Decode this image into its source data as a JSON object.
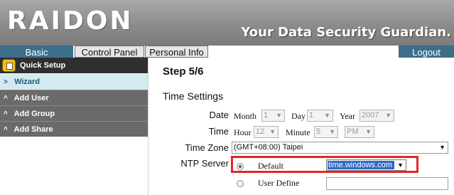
{
  "header": {
    "logo": "RAIDON",
    "tagline": "Your Data Security Guardian."
  },
  "nav": {
    "tabs": [
      "Basic",
      "Control Panel",
      "Personal Info"
    ],
    "logout": "Logout"
  },
  "sidebar": {
    "section": "Quick Setup",
    "items": [
      {
        "label": "Wizard",
        "arrow": ">"
      },
      {
        "label": "Add User",
        "arrow": "^"
      },
      {
        "label": "Add Group",
        "arrow": "^"
      },
      {
        "label": "Add Share",
        "arrow": "^"
      }
    ]
  },
  "main": {
    "step": "Step 5/6",
    "section": "Time Settings",
    "date": {
      "label": "Date",
      "month_label": "Month",
      "month": "1",
      "day_label": "Day",
      "day": "1",
      "year_label": "Year",
      "year": "2007"
    },
    "time": {
      "label": "Time",
      "hour_label": "Hour",
      "hour": "12",
      "minute_label": "Minute",
      "minute": "5",
      "ampm": "PM"
    },
    "timezone": {
      "label": "Time Zone",
      "value": "(GMT+08:00) Taipei"
    },
    "ntp": {
      "label": "NTP Server",
      "default_label": "Default",
      "default_value": "time.windows.com",
      "user_label": "User Define",
      "user_value": ""
    }
  },
  "colors": {
    "accent": "#3c6e8c",
    "highlight": "#e52626"
  }
}
